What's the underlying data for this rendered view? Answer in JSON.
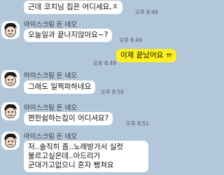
{
  "messages": [
    {
      "sender": "",
      "text": "근데 코치님 집은 어디세요,ㅈ",
      "time": "오후 8:46"
    },
    {
      "sender": "아이스크림 돈 네오",
      "text": "오늘일과 끝나지않아요~?",
      "time": "오후 8:49"
    },
    {
      "sender": "",
      "text": "이제 끝났어요 ㅠ",
      "time": "오후 8:49"
    },
    {
      "sender": "아이스크림 돈 네오",
      "text": "그래도 일찍파하네요",
      "time": "오후 8:50"
    },
    {
      "sender": "아이스크림 돈 네오",
      "text": "편한쉼하는집이 어디셔요?",
      "time": "오후 8:51"
    },
    {
      "sender": "아이스크림 돈 네오",
      "lines": [
        "저..솔직히 좀..노래방가서 실컷",
        "불르고싶은데..아드리가",
        "군대가고없으니 혼자 뻥쳐요"
      ],
      "time": ""
    }
  ],
  "colors": {
    "background": "#b2c7d9",
    "incoming_bubble": "#ffffff",
    "outgoing_bubble": "#fef01b"
  },
  "icons": {
    "avatar": "cartoon-face-avatar-icon"
  }
}
